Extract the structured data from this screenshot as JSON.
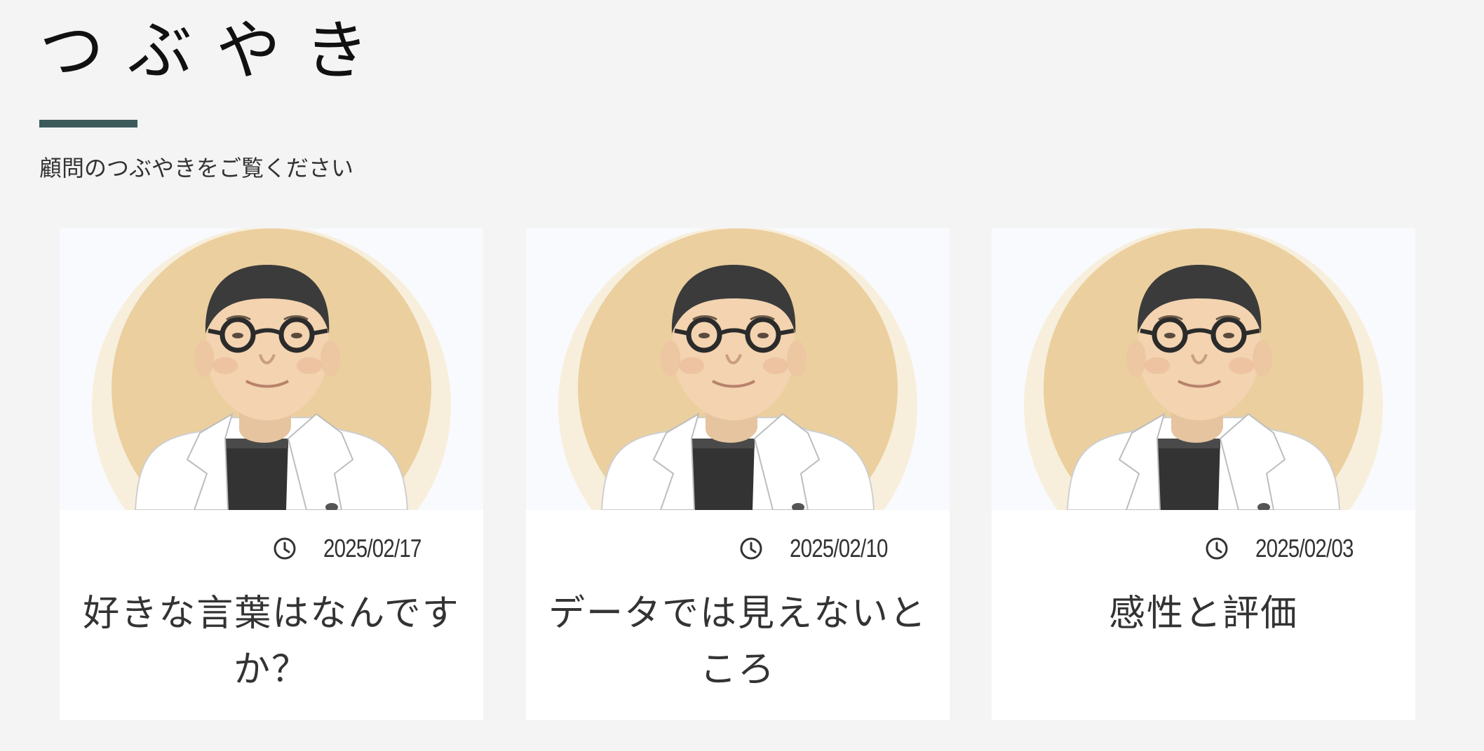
{
  "section": {
    "title": "つぶやき",
    "subtitle": "顧問のつぶやきをご覧ください",
    "accent_color": "#3c5a5a"
  },
  "posts": [
    {
      "date": "2025/02/17",
      "title": "好きな言葉はなんですか？",
      "date_icon": "clock-icon",
      "image": "advisor-portrait"
    },
    {
      "date": "2025/02/10",
      "title": "データでは見えないところ",
      "date_icon": "clock-icon",
      "image": "advisor-portrait"
    },
    {
      "date": "2025/02/03",
      "title": "感性と評価",
      "date_icon": "clock-icon",
      "image": "advisor-portrait"
    }
  ]
}
